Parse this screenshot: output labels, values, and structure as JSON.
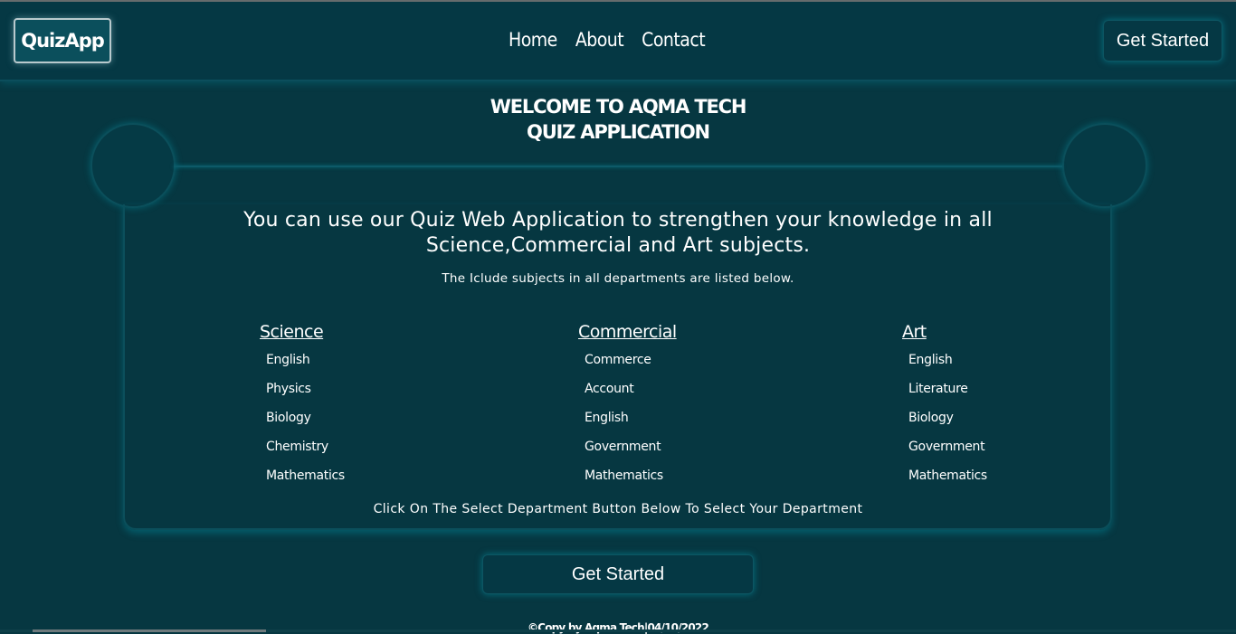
{
  "nav": {
    "logo": "QuizApp",
    "links": [
      "Home",
      "About",
      "Contact"
    ],
    "cta": "Get Started"
  },
  "hero": {
    "title_line1": "WELCOME TO AQMA TECH",
    "title_line2": "QUIZ APPLICATION",
    "intro": "You can use our Quiz Web Application to strengthen your knowledge in all Science,Commercial and Art subjects.",
    "subtitle": "The Iclude subjects in all departments are listed below."
  },
  "departments": [
    {
      "name": "Science",
      "subjects": [
        "English",
        "Physics",
        "Biology",
        "Chemistry",
        "Mathematics"
      ]
    },
    {
      "name": "Commercial",
      "subjects": [
        "Commerce",
        "Account",
        "English",
        "Government",
        "Mathematics"
      ]
    },
    {
      "name": "Art",
      "subjects": [
        "English",
        "Literature",
        "Biology",
        "Government",
        "Mathematics"
      ]
    }
  ],
  "footnote": "Click On The Select Department Button Below To Select Your Department",
  "main_cta": "Get Started",
  "copyright": "©Copy by Aqma Tech|04/10/2022",
  "colors": {
    "background": "#063741",
    "border_glow": "#0b4f5b",
    "text": "#ffffff"
  }
}
